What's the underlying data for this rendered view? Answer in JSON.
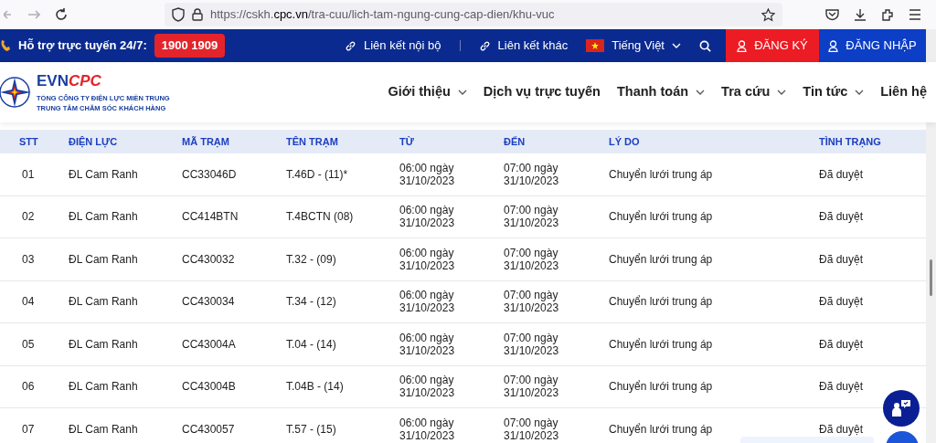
{
  "browser": {
    "url_prefix": "https://cskh.",
    "url_domain": "cpc.vn",
    "url_path": "/tra-cuu/lich-tam-ngung-cung-cap-dien/khu-vuc"
  },
  "top_bar": {
    "support_label": "Hỗ trợ trực tuyến 24/7:",
    "hotline": "1900 1909",
    "links": [
      "Liên kết nội bộ",
      "Liên kết khác"
    ],
    "language": "Tiếng Việt",
    "register": "ĐĂNG KÝ",
    "login": "ĐĂNG NHẬP"
  },
  "header": {
    "logo_prefix": "EVN",
    "logo_suffix": "CPC",
    "company_lines": [
      "TỔNG CÔNG TY ĐIỆN LỰC MIỀN TRUNG",
      "TRUNG TÂM CHĂM SÓC KHÁCH HÀNG"
    ],
    "nav": [
      {
        "label": "Giới thiệu",
        "dropdown": true
      },
      {
        "label": "Dịch vụ trực tuyến",
        "dropdown": false
      },
      {
        "label": "Thanh toán",
        "dropdown": true
      },
      {
        "label": "Tra cứu",
        "dropdown": true
      },
      {
        "label": "Tin tức",
        "dropdown": true
      },
      {
        "label": "Liên hệ",
        "dropdown": false
      }
    ]
  },
  "table": {
    "columns": [
      "STT",
      "ĐIỆN LỰC",
      "MÃ TRẠM",
      "TÊN TRẠM",
      "TỪ",
      "ĐẾN",
      "LÝ DO",
      "TÌNH TRẠNG"
    ],
    "rows": [
      [
        "01",
        "ĐL Cam Ranh",
        "CC33046D",
        "T.46D - (11)*",
        "06:00 ngày 31/10/2023",
        "07:00 ngày 31/10/2023",
        "Chuyển lưới trung áp",
        "Đã duyệt"
      ],
      [
        "02",
        "ĐL Cam Ranh",
        "CC414BTN",
        "T.4BCTN (08)",
        "06:00 ngày 31/10/2023",
        "07:00 ngày 31/10/2023",
        "Chuyển lưới trung áp",
        "Đã duyệt"
      ],
      [
        "03",
        "ĐL Cam Ranh",
        "CC430032",
        "T.32 - (09)",
        "06:00 ngày 31/10/2023",
        "07:00 ngày 31/10/2023",
        "Chuyển lưới trung áp",
        "Đã duyệt"
      ],
      [
        "04",
        "ĐL Cam Ranh",
        "CC430034",
        "T.34 - (12)",
        "06:00 ngày 31/10/2023",
        "07:00 ngày 31/10/2023",
        "Chuyển lưới trung áp",
        "Đã duyệt"
      ],
      [
        "05",
        "ĐL Cam Ranh",
        "CC43004A",
        "T.04 - (14)",
        "06:00 ngày 31/10/2023",
        "07:00 ngày 31/10/2023",
        "Chuyển lưới trung áp",
        "Đã duyệt"
      ],
      [
        "06",
        "ĐL Cam Ranh",
        "CC43004B",
        "T.04B - (14)",
        "06:00 ngày 31/10/2023",
        "07:00 ngày 31/10/2023",
        "Chuyển lưới trung áp",
        "Đã duyệt"
      ],
      [
        "07",
        "ĐL Cam Ranh",
        "CC430057",
        "T.57 - (15)",
        "06:00 ngày 31/10/2023",
        "07:00 ngày 31/10/2023",
        "Chuyển lưới trung áp",
        "Đã duyệt"
      ]
    ]
  }
}
